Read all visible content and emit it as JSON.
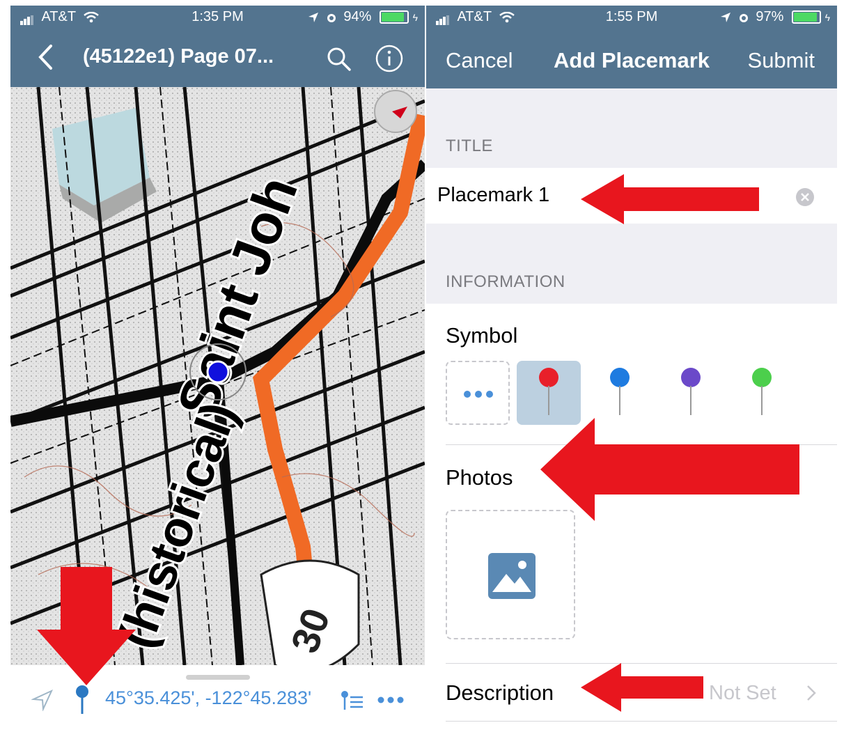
{
  "left_phone": {
    "status_bar": {
      "carrier": "AT&T",
      "time": "1:35 PM",
      "battery": "94%",
      "battery_level": 0.94
    },
    "nav": {
      "title": "(45122e1) Page 07..."
    },
    "map": {
      "road_label": "Saint Joh",
      "historical_label": "(historical)",
      "route_shield": "30"
    },
    "bottom_bar": {
      "coordinates": "45°35.425', -122°45.283'"
    }
  },
  "right_phone": {
    "status_bar": {
      "carrier": "AT&T",
      "time": "1:55 PM",
      "battery": "97%",
      "battery_level": 0.97
    },
    "nav": {
      "cancel": "Cancel",
      "title": "Add Placemark",
      "submit": "Submit"
    },
    "title_section": {
      "header": "TITLE",
      "value": "Placemark 1"
    },
    "information_section": {
      "header": "INFORMATION",
      "symbol_label": "Symbol",
      "symbols": [
        {
          "name": "more",
          "color": "#4a90d9"
        },
        {
          "name": "red-pin",
          "color": "#e8202a",
          "selected": true
        },
        {
          "name": "blue-pin",
          "color": "#1e7be0"
        },
        {
          "name": "purple-pin",
          "color": "#6b49c9"
        },
        {
          "name": "green-pin",
          "color": "#4ccf4c"
        }
      ],
      "photos_label": "Photos",
      "description_label": "Description",
      "description_value": "Not Set"
    }
  },
  "colors": {
    "nav": "#53748f",
    "accent": "#4a90d9",
    "arrow": "#e8161e",
    "route": "#f06a25"
  }
}
